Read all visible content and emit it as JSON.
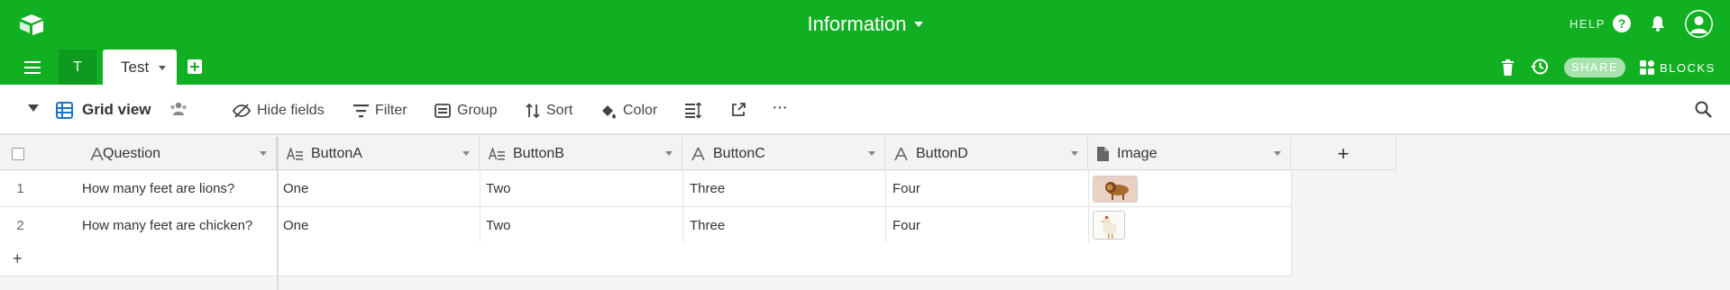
{
  "app": {
    "base_title": "Information",
    "help_label": "HELP",
    "help_glyph": "?",
    "accent_color": "#11af22"
  },
  "tables": {
    "collapsed_tab_label": "T",
    "active_tab_label": "Test"
  },
  "header_actions": {
    "share_label": "SHARE",
    "blocks_label": "BLOCKS"
  },
  "view": {
    "name": "Grid view",
    "toolbar": {
      "hide_fields": "Hide fields",
      "filter": "Filter",
      "group": "Group",
      "sort": "Sort",
      "color": "Color",
      "more": "···"
    }
  },
  "grid": {
    "columns": [
      {
        "name": "Question",
        "type_icon": "text-icon"
      },
      {
        "name": "ButtonA",
        "type_icon": "long-text-icon"
      },
      {
        "name": "ButtonB",
        "type_icon": "long-text-icon"
      },
      {
        "name": "ButtonC",
        "type_icon": "text-icon"
      },
      {
        "name": "ButtonD",
        "type_icon": "text-icon"
      },
      {
        "name": "Image",
        "type_icon": "attachment-icon"
      }
    ],
    "add_column_label": "+",
    "add_row_label": "+",
    "rows": [
      {
        "num": "1",
        "question": "How many feet are lions?",
        "a": "One",
        "b": "Two",
        "c": "Three",
        "d": "Four",
        "image": "lion thumbnail"
      },
      {
        "num": "2",
        "question": "How many feet are chicken?",
        "a": "One",
        "b": "Two",
        "c": "Three",
        "d": "Four",
        "image": "chicken thumbnail"
      }
    ]
  }
}
